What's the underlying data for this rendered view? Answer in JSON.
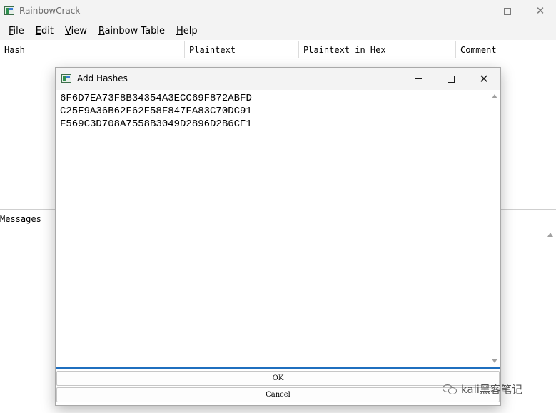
{
  "app": {
    "title": "RainbowCrack",
    "menu": [
      {
        "label": "File",
        "mnemonic": "F",
        "rest": "ile"
      },
      {
        "label": "Edit",
        "mnemonic": "E",
        "rest": "dit"
      },
      {
        "label": "View",
        "mnemonic": "V",
        "rest": "iew"
      },
      {
        "label": "Rainbow Table",
        "mnemonic": "R",
        "rest": "ainbow Table"
      },
      {
        "label": "Help",
        "mnemonic": "H",
        "rest": "elp"
      }
    ],
    "table_columns": [
      "Hash",
      "Plaintext",
      "Plaintext in Hex",
      "Comment"
    ],
    "messages_label": "Messages"
  },
  "dialog": {
    "title": "Add Hashes",
    "hashes": [
      "6F6D7EA73F8B34354A3ECC69F872ABFD",
      "C25E9A36B62F62F58F847FA83C70DC91",
      "F569C3D708A7558B3049D2896D2B6CE1"
    ],
    "ok_label": "OK",
    "cancel_label": "Cancel"
  },
  "watermark": {
    "text": "kali黑客笔记"
  },
  "colors": {
    "focus_accent": "#1f6fbf",
    "titlebar_bg": "#f3f3f3"
  }
}
